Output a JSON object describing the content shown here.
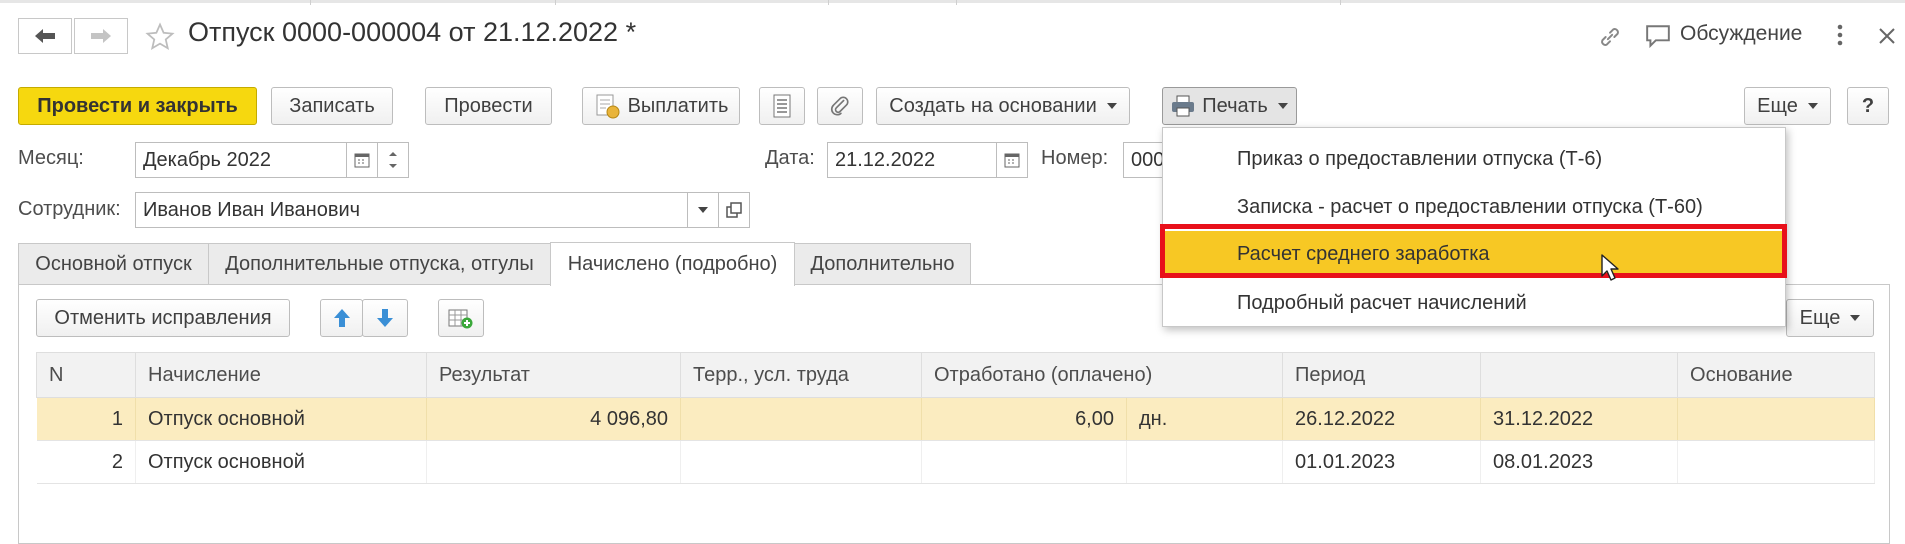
{
  "header": {
    "title": "Отпуск 0000-000004 от 21.12.2022 *",
    "discussion_label": "Обсуждение"
  },
  "toolbar": {
    "post_close_label": "Провести и закрыть",
    "save_label": "Записать",
    "post_label": "Провести",
    "pay_label": "Выплатить",
    "create_based_label": "Создать на основании",
    "print_label": "Печать",
    "more_label": "Еще",
    "help_label": "?"
  },
  "form": {
    "month_label": "Месяц:",
    "month_value": "Декабрь 2022",
    "date_label": "Дата:",
    "date_value": "21.12.2022",
    "number_label": "Номер:",
    "number_value": "000",
    "employee_label": "Сотрудник:",
    "employee_value": "Иванов Иван Иванович"
  },
  "tabs": [
    {
      "label": "Основной отпуск",
      "active": false
    },
    {
      "label": "Дополнительные отпуска, отгулы",
      "active": false
    },
    {
      "label": "Начислено (подробно)",
      "active": true
    },
    {
      "label": "Дополнительно",
      "active": false
    }
  ],
  "panel": {
    "cancel_corrections_label": "Отменить исправления",
    "more_label": "Еще"
  },
  "table": {
    "columns": [
      "N",
      "Начисление",
      "Результат",
      "Терр., усл. труда",
      "Отработано (оплачено)",
      "",
      "Период",
      "",
      "Основание"
    ],
    "rows": [
      {
        "n": "1",
        "accrual": "Отпуск основной",
        "result": "4 096,80",
        "terr": "",
        "worked": "6,00",
        "unit": "дн.",
        "from": "26.12.2022",
        "to": "31.12.2022",
        "basis": "",
        "selected": true
      },
      {
        "n": "2",
        "accrual": "Отпуск основной",
        "result": "",
        "terr": "",
        "worked": "",
        "unit": "",
        "from": "01.01.2023",
        "to": "08.01.2023",
        "basis": "",
        "selected": false
      }
    ]
  },
  "print_menu": {
    "items": [
      {
        "label": "Приказ о предоставлении отпуска (Т-6)",
        "highlighted": false
      },
      {
        "label": "Записка - расчет о предоставлении отпуска (Т-60)",
        "highlighted": false
      },
      {
        "label": "Расчет среднего заработка",
        "highlighted": true
      },
      {
        "label": "Подробный расчет начислений",
        "highlighted": false
      }
    ]
  },
  "colors": {
    "accent_button": "#f6d80f",
    "menu_highlight": "#f7c824",
    "selection_outline": "#e8101a",
    "selected_row": "#fbecc0"
  },
  "icons": [
    "back-arrow-icon",
    "forward-arrow-icon",
    "star-icon",
    "link-icon",
    "discussion-icon",
    "kebab-menu-icon",
    "close-icon",
    "pay-icon",
    "document-icon",
    "paperclip-icon",
    "printer-icon",
    "calendar-icon",
    "spin-icon",
    "dropdown-icon",
    "open-icon",
    "arrow-up-icon",
    "arrow-down-icon",
    "table-add-icon",
    "mouse-cursor-icon"
  ]
}
